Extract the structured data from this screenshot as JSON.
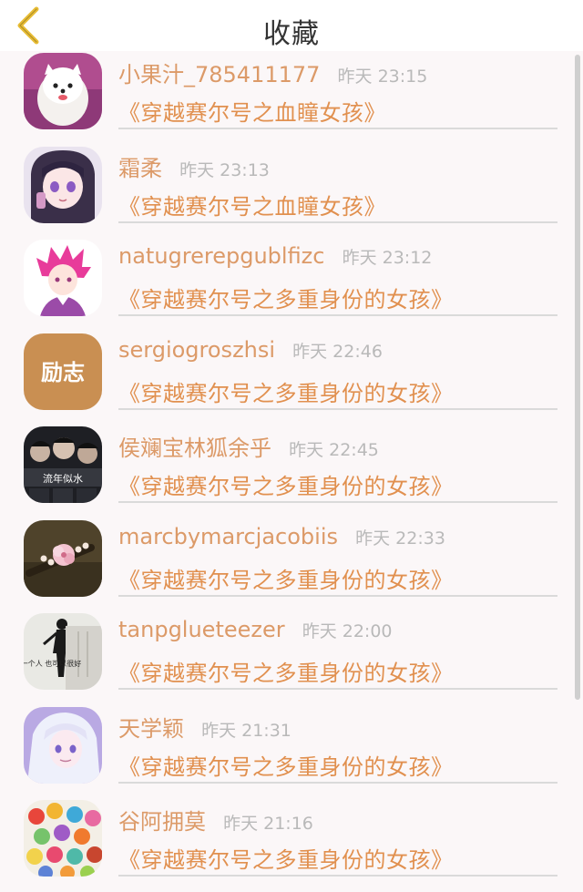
{
  "header": {
    "title": "收藏",
    "back_icon": "chevron-left-icon",
    "back_color": "#e8bd35"
  },
  "items": [
    {
      "user": "小果汁_785411177",
      "time": "昨天 23:15",
      "book": "《穿越赛尔号之血瞳女孩》",
      "avatar": "white dog"
    },
    {
      "user": "霜柔",
      "time": "昨天 23:13",
      "book": "《穿越赛尔号之血瞳女孩》",
      "avatar": "anime girl"
    },
    {
      "user": "natugrerepgublfizc",
      "time": "昨天 23:12",
      "book": "《穿越赛尔号之多重身份的女孩》",
      "avatar": "pink hair anime boy"
    },
    {
      "user": "sergiogroszhsi",
      "time": "昨天 22:46",
      "book": "《穿越赛尔号之多重身份的女孩》",
      "avatar_text": "励志"
    },
    {
      "user": "侯斓宝林狐余乎",
      "time": "昨天 22:45",
      "book": "《穿越赛尔号之多重身份的女孩》",
      "avatar_text": "流年似水"
    },
    {
      "user": "marcbymarcjacobiis",
      "time": "昨天 22:33",
      "book": "《穿越赛尔号之多重身份的女孩》",
      "avatar": "flower hairpin"
    },
    {
      "user": "tanpglueteezer",
      "time": "昨天 22:00",
      "book": "《穿越赛尔号之多重身份的女孩》",
      "avatar_text": "一个人 也可以很好"
    },
    {
      "user": "天学颖",
      "time": "昨天 21:31",
      "book": "《穿越赛尔号之多重身份的女孩》",
      "avatar": "white hair anime"
    },
    {
      "user": "谷阿拥莫",
      "time": "昨天 21:16",
      "book": "《穿越赛尔号之多重身份的女孩》",
      "avatar": "origami candies"
    }
  ],
  "colors": {
    "username": "#dc9a68",
    "book_title": "#e1904f",
    "timestamp": "#b9b9b9",
    "background": "#fbf7f8"
  }
}
